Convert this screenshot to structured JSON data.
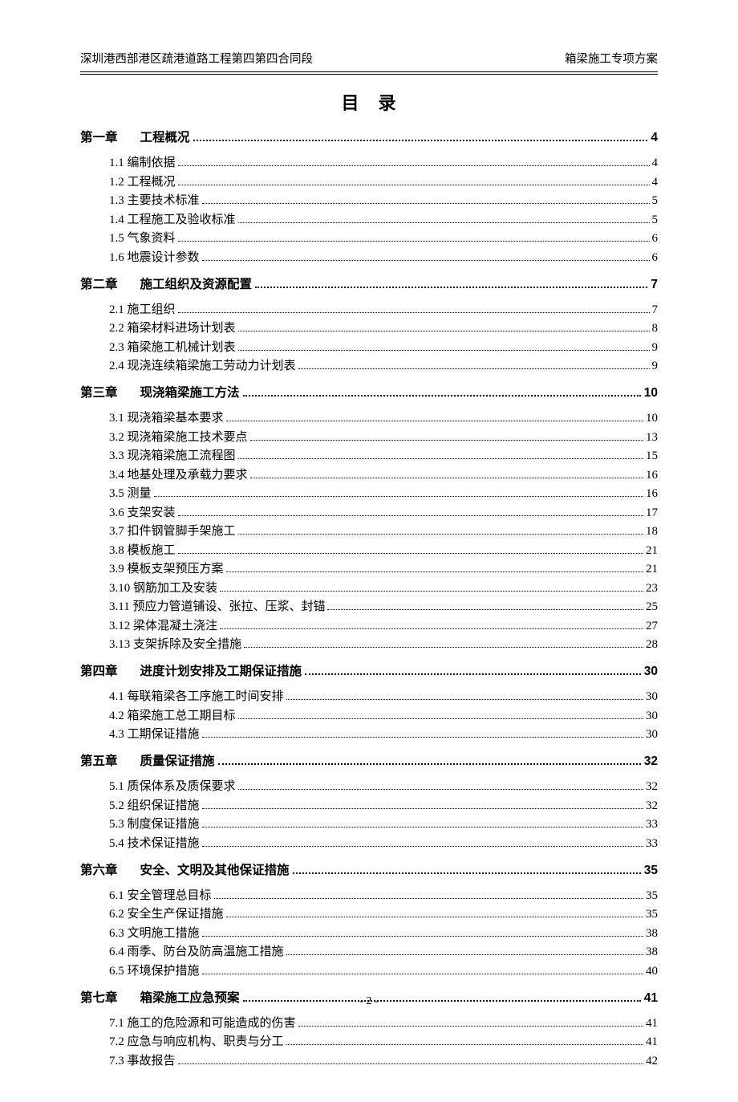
{
  "header": {
    "left": "深圳港西部港区疏港道路工程第四第四合同段",
    "right": "箱梁施工专项方案"
  },
  "title": "目　录",
  "chapters": [
    {
      "label": "第一章",
      "title": "工程概况",
      "page": "4",
      "items": [
        {
          "num": "1.1 ",
          "title": "编制依据",
          "page": "4"
        },
        {
          "num": "1.2 ",
          "title": "工程概况",
          "page": "4"
        },
        {
          "num": "1.3 ",
          "title": "主要技术标准",
          "page": "5"
        },
        {
          "num": "1.4 ",
          "title": "工程施工及验收标准",
          "page": "5"
        },
        {
          "num": "1.5 ",
          "title": "气象资料",
          "page": "6"
        },
        {
          "num": "1.6 ",
          "title": "地震设计参数",
          "page": "6"
        }
      ]
    },
    {
      "label": "第二章",
      "title": "施工组织及资源配置",
      "page": "7",
      "items": [
        {
          "num": "2.1 ",
          "title": "施工组织",
          "page": "7"
        },
        {
          "num": "2.2 ",
          "title": "箱梁材料进场计划表",
          "page": "8"
        },
        {
          "num": "2.3 ",
          "title": "箱梁施工机械计划表",
          "page": "9"
        },
        {
          "num": "2.4 ",
          "title": "现浇连续箱梁施工劳动力计划表",
          "page": "9"
        }
      ]
    },
    {
      "label": "第三章",
      "title": "现浇箱梁施工方法",
      "page": "10",
      "items": [
        {
          "num": "3.1 ",
          "title": "现浇箱梁基本要求",
          "page": "10"
        },
        {
          "num": "3.2 ",
          "title": "现浇箱梁施工技术要点",
          "page": "13"
        },
        {
          "num": "3.3 ",
          "title": "现浇箱梁施工流程图",
          "page": "15"
        },
        {
          "num": "3.4 ",
          "title": "地基处理及承载力要求",
          "page": "16"
        },
        {
          "num": "3.5 ",
          "title": "测量",
          "page": "16"
        },
        {
          "num": "3.6 ",
          "title": "支架安装",
          "page": "17"
        },
        {
          "num": "3.7 ",
          "title": "扣件钢管脚手架施工",
          "page": "18"
        },
        {
          "num": "3.8 ",
          "title": "模板施工",
          "page": "21"
        },
        {
          "num": "3.9 ",
          "title": "模板支架预压方案",
          "page": "21"
        },
        {
          "num": "3.10 ",
          "title": "钢筋加工及安装",
          "page": "23"
        },
        {
          "num": "3.11 ",
          "title": "预应力管道铺设、张拉、压浆、封锚",
          "page": "25"
        },
        {
          "num": "3.12 ",
          "title": "梁体混凝土浇注",
          "page": "27"
        },
        {
          "num": "3.13 ",
          "title": "支架拆除及安全措施",
          "page": "28"
        }
      ]
    },
    {
      "label": "第四章",
      "title": "进度计划安排及工期保证措施 ",
      "page": "30",
      "items": [
        {
          "num": "4.1 ",
          "title": "每联箱梁各工序施工时间安排",
          "page": "30"
        },
        {
          "num": "4.2 ",
          "title": "箱梁施工总工期目标",
          "page": "30"
        },
        {
          "num": "4.3 ",
          "title": "工期保证措施",
          "page": "30"
        }
      ]
    },
    {
      "label": "第五章",
      "title": "质量保证措施",
      "page": "32",
      "items": [
        {
          "num": "5.1 ",
          "title": "质保体系及质保要求",
          "page": "32"
        },
        {
          "num": "5.2 ",
          "title": "组织保证措施",
          "page": "32"
        },
        {
          "num": "5.3 ",
          "title": "制度保证措施",
          "page": "33"
        },
        {
          "num": "5.4 ",
          "title": "技术保证措施",
          "page": "33"
        }
      ]
    },
    {
      "label": "第六章",
      "title": "安全、文明及其他保证措施 ",
      "page": "35",
      "items": [
        {
          "num": "6.1 ",
          "title": "安全管理总目标",
          "page": "35"
        },
        {
          "num": "6.2 ",
          "title": "安全生产保证措施",
          "page": "35"
        },
        {
          "num": "6.3 ",
          "title": "文明施工措施",
          "page": "38"
        },
        {
          "num": "6.4 ",
          "title": "雨季、防台及防高温施工措施",
          "page": "38"
        },
        {
          "num": "6.5 ",
          "title": "环境保护措施",
          "page": "40"
        }
      ]
    },
    {
      "label": "第七章",
      "title": "箱梁施工应急预案 ",
      "page": "41",
      "items": [
        {
          "num": "7.1 ",
          "title": "施工的危险源和可能造成的伤害",
          "page": "41"
        },
        {
          "num": "7.2 ",
          "title": "应急与响应机构、职责与分工",
          "page": "41"
        },
        {
          "num": "7.3 ",
          "title": "事故报告",
          "page": "42"
        }
      ]
    }
  ],
  "footer": "- 2 -"
}
